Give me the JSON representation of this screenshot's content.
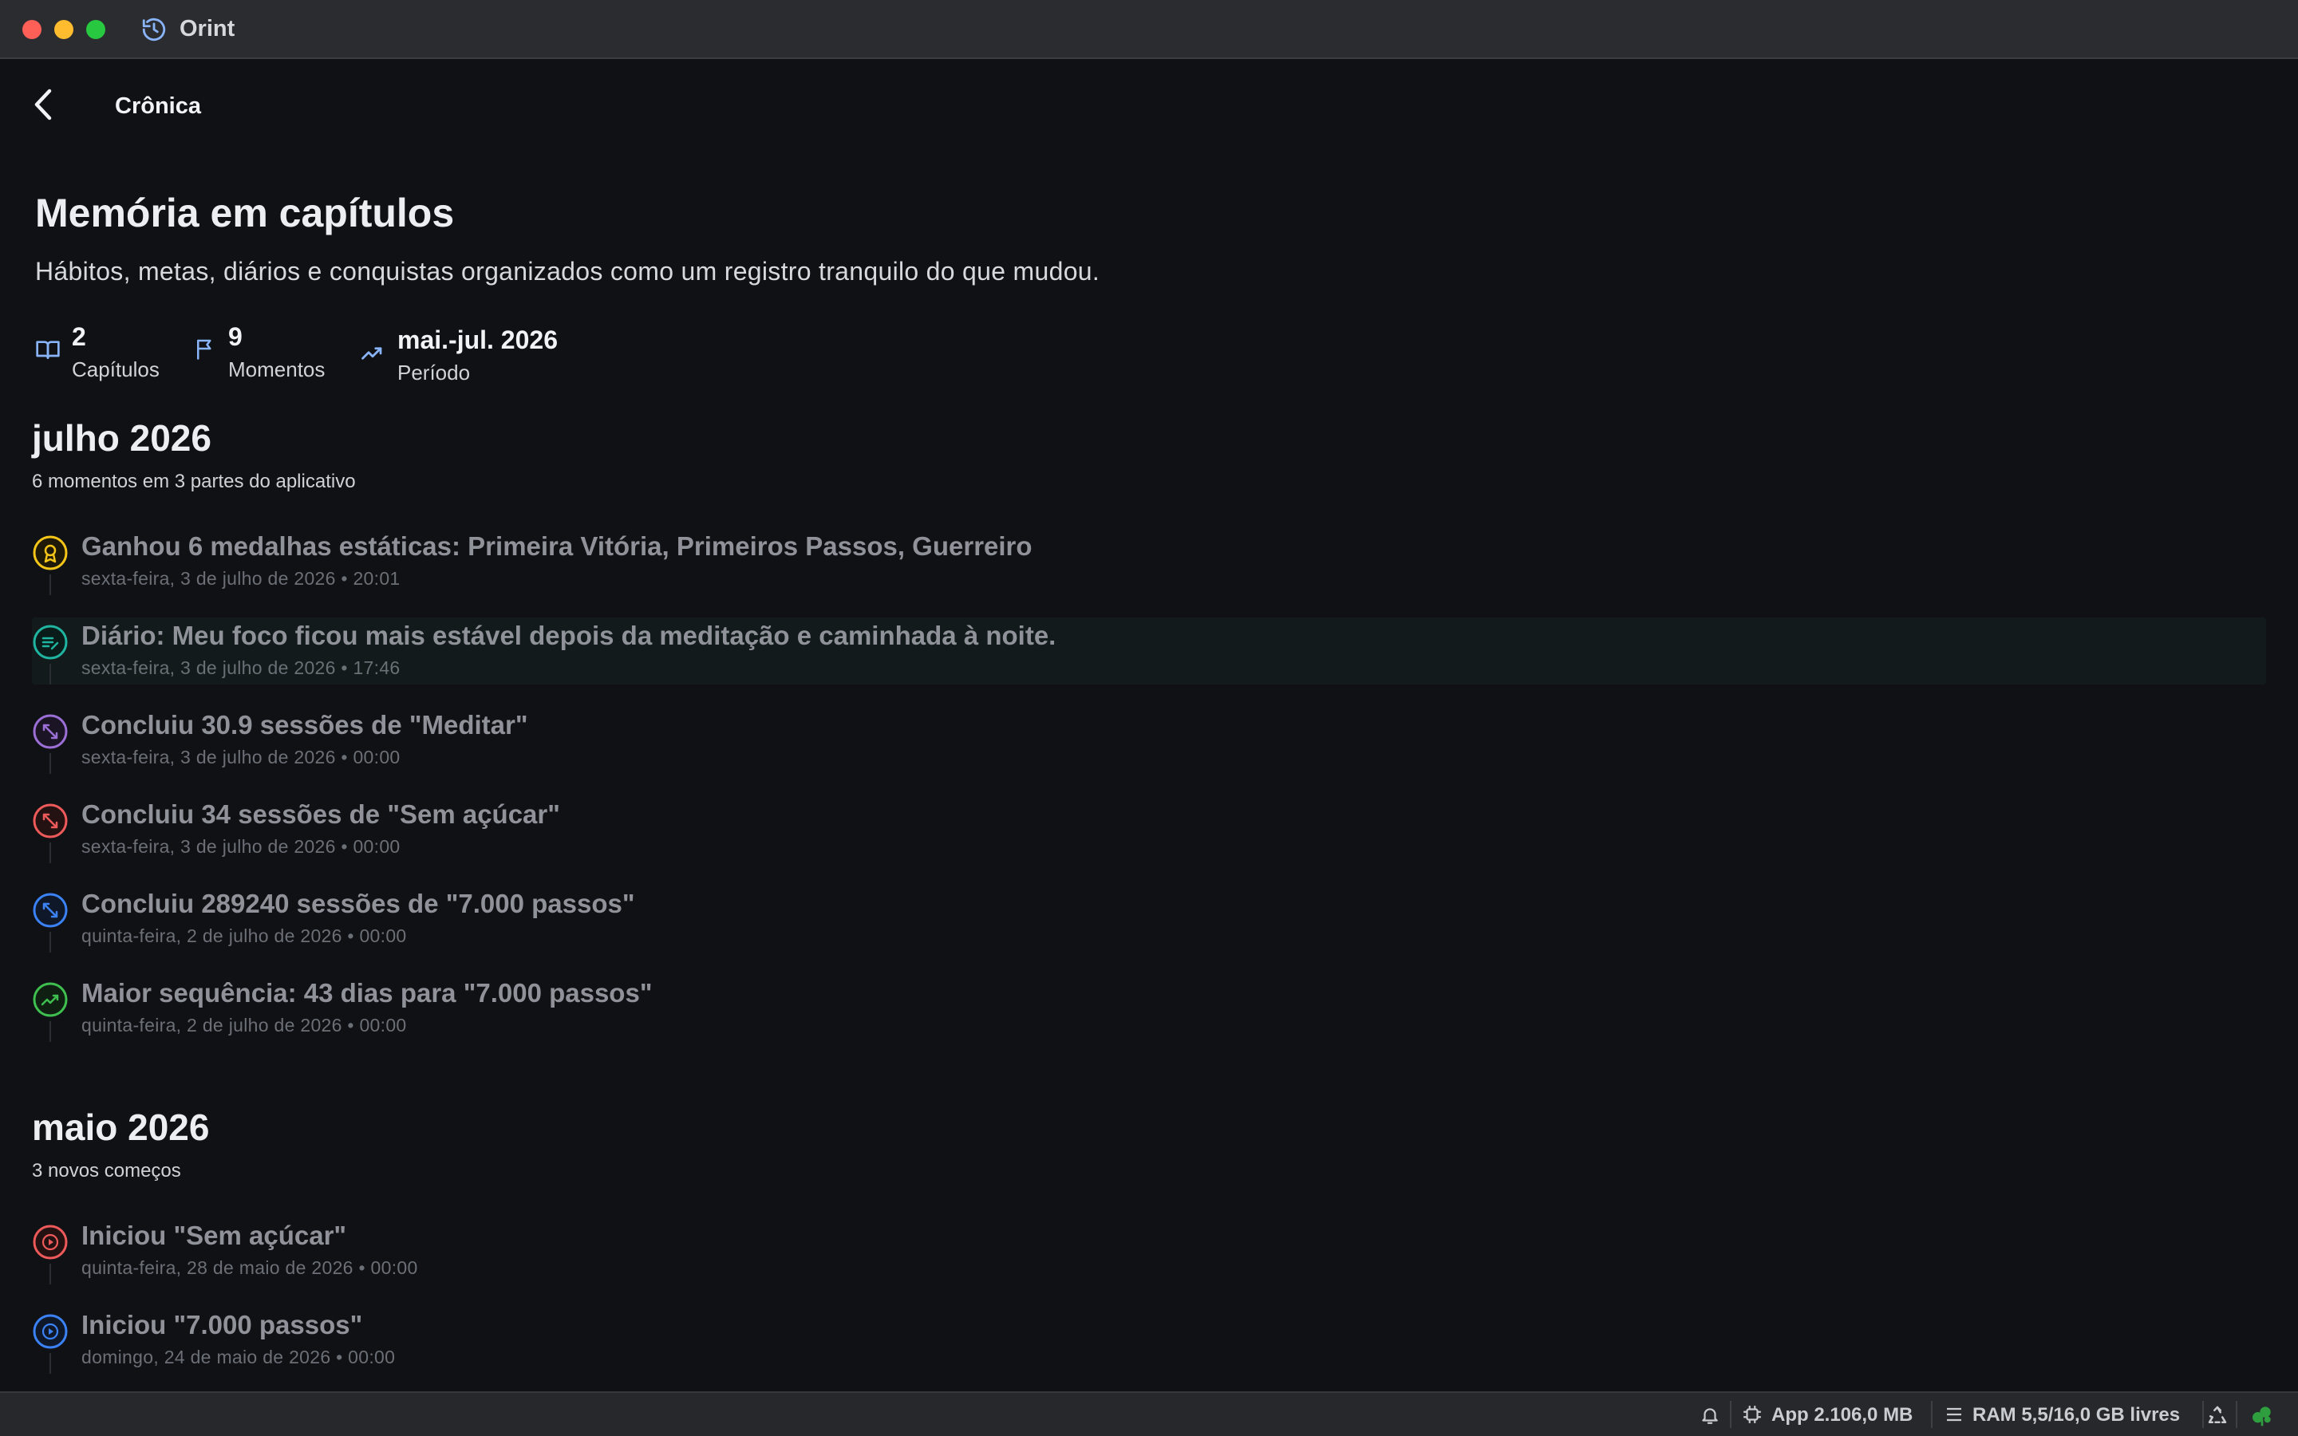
{
  "window": {
    "title": "Orint"
  },
  "nav": {
    "section": "Crônica"
  },
  "page": {
    "title": "Memória em capítulos",
    "subtitle": "Hábitos, metas, diários e conquistas organizados como um registro tranquilo do que mudou."
  },
  "stats": [
    {
      "value": "2",
      "label": "Capítulos",
      "icon": "book-icon"
    },
    {
      "value": "9",
      "label": "Momentos",
      "icon": "flag-icon"
    },
    {
      "value": "mai.-jul. 2026",
      "label": "Período",
      "icon": "trend-icon"
    }
  ],
  "sections": [
    {
      "title": "julho 2026",
      "subtitle": "6 momentos em 3 partes do aplicativo",
      "events": [
        {
          "title": "Ganhou 6 medalhas estáticas: Primeira Vitória, Primeiros Passos, Guerreiro",
          "date": "sexta-feira, 3 de julho de 2026 • 20:01",
          "icon": "medal-icon",
          "color": "#f5c518"
        },
        {
          "title": "Diário: Meu foco ficou mais estável depois da meditação e caminhada à noite.",
          "date": "sexta-feira, 3 de julho de 2026 • 17:46",
          "icon": "journal-icon",
          "color": "#1fb5a0"
        },
        {
          "title": "Concluiu 30.9 sessões de \"Meditar\"",
          "date": "sexta-feira, 3 de julho de 2026 • 00:00",
          "icon": "arrows-icon",
          "color": "#9b6fd6"
        },
        {
          "title": "Concluiu 34 sessões de \"Sem açúcar\"",
          "date": "sexta-feira, 3 de julho de 2026 • 00:00",
          "icon": "arrows-icon",
          "color": "#ee5a5a"
        },
        {
          "title": "Concluiu 289240 sessões de \"7.000 passos\"",
          "date": "quinta-feira, 2 de julho de 2026 • 00:00",
          "icon": "arrows-icon",
          "color": "#3b82f6"
        },
        {
          "title": "Maior sequência: 43 dias para \"7.000 passos\"",
          "date": "quinta-feira, 2 de julho de 2026 • 00:00",
          "icon": "trend-icon",
          "color": "#3fbf4f"
        }
      ]
    },
    {
      "title": "maio 2026",
      "subtitle": "3 novos começos",
      "events": [
        {
          "title": "Iniciou \"Sem açúcar\"",
          "date": "quinta-feira, 28 de maio de 2026 • 00:00",
          "icon": "play-icon",
          "color": "#ee5a5a"
        },
        {
          "title": "Iniciou \"7.000 passos\"",
          "date": "domingo, 24 de maio de 2026 • 00:00",
          "icon": "play-icon",
          "color": "#3b82f6"
        }
      ]
    }
  ],
  "statusbar": {
    "app_mem": "App 2.106,0 MB",
    "ram": "RAM 5,5/16,0 GB livres"
  },
  "colors": {
    "accent": "#8ab4f8",
    "background": "#0f1115"
  }
}
